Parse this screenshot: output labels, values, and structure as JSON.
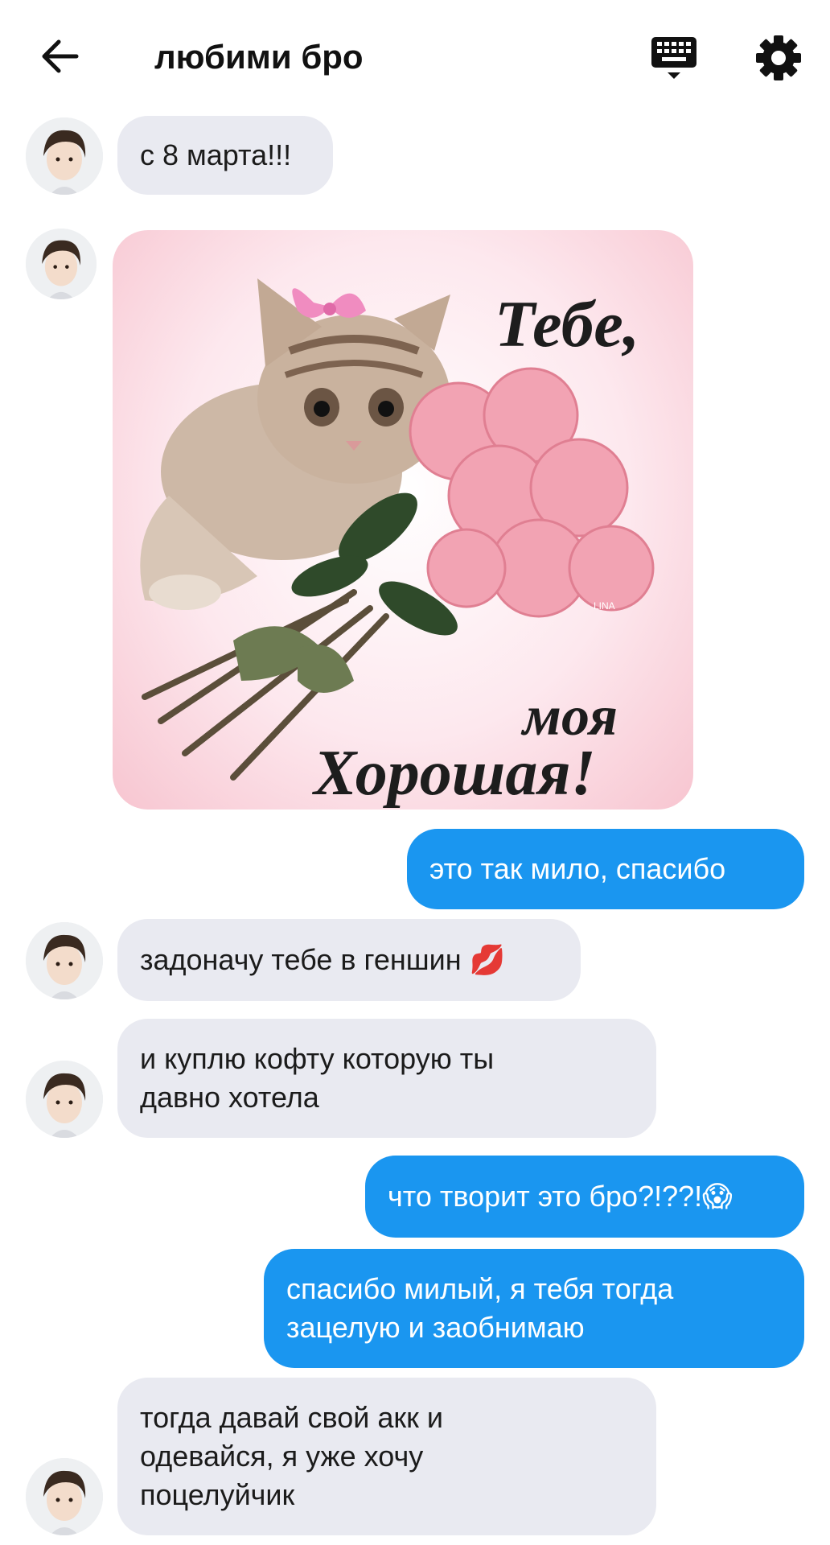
{
  "header": {
    "title": "любими бро",
    "back_icon": "arrow-left-icon",
    "keyboard_icon": "keyboard-icon",
    "settings_icon": "gear-icon"
  },
  "colors": {
    "incoming_bubble": "#e9eaf1",
    "outgoing_bubble": "#1a96f0",
    "outgoing_text": "#ffffff"
  },
  "messages": [
    {
      "side": "in",
      "text": "с 8 марта!!!"
    },
    {
      "side": "in",
      "type": "image",
      "image_text": [
        "Тебе,",
        "моя",
        "Хорошая!"
      ],
      "image_signature": "LINA"
    },
    {
      "side": "out",
      "text": "это так мило, спасибо"
    },
    {
      "side": "in",
      "text": "задоначу тебе в геншин 💋"
    },
    {
      "side": "in",
      "text": "и куплю кофту которую ты\nдавно хотела"
    },
    {
      "side": "out",
      "text": "что творит это бро?!??!😱"
    },
    {
      "side": "out",
      "text": "спасибо милый, я тебя тогда\nзацелую и заобнимаю"
    },
    {
      "side": "in",
      "text": "тогда давай свой акк и\nодевайся, я уже хочу\nпоцелуйчик"
    }
  ]
}
